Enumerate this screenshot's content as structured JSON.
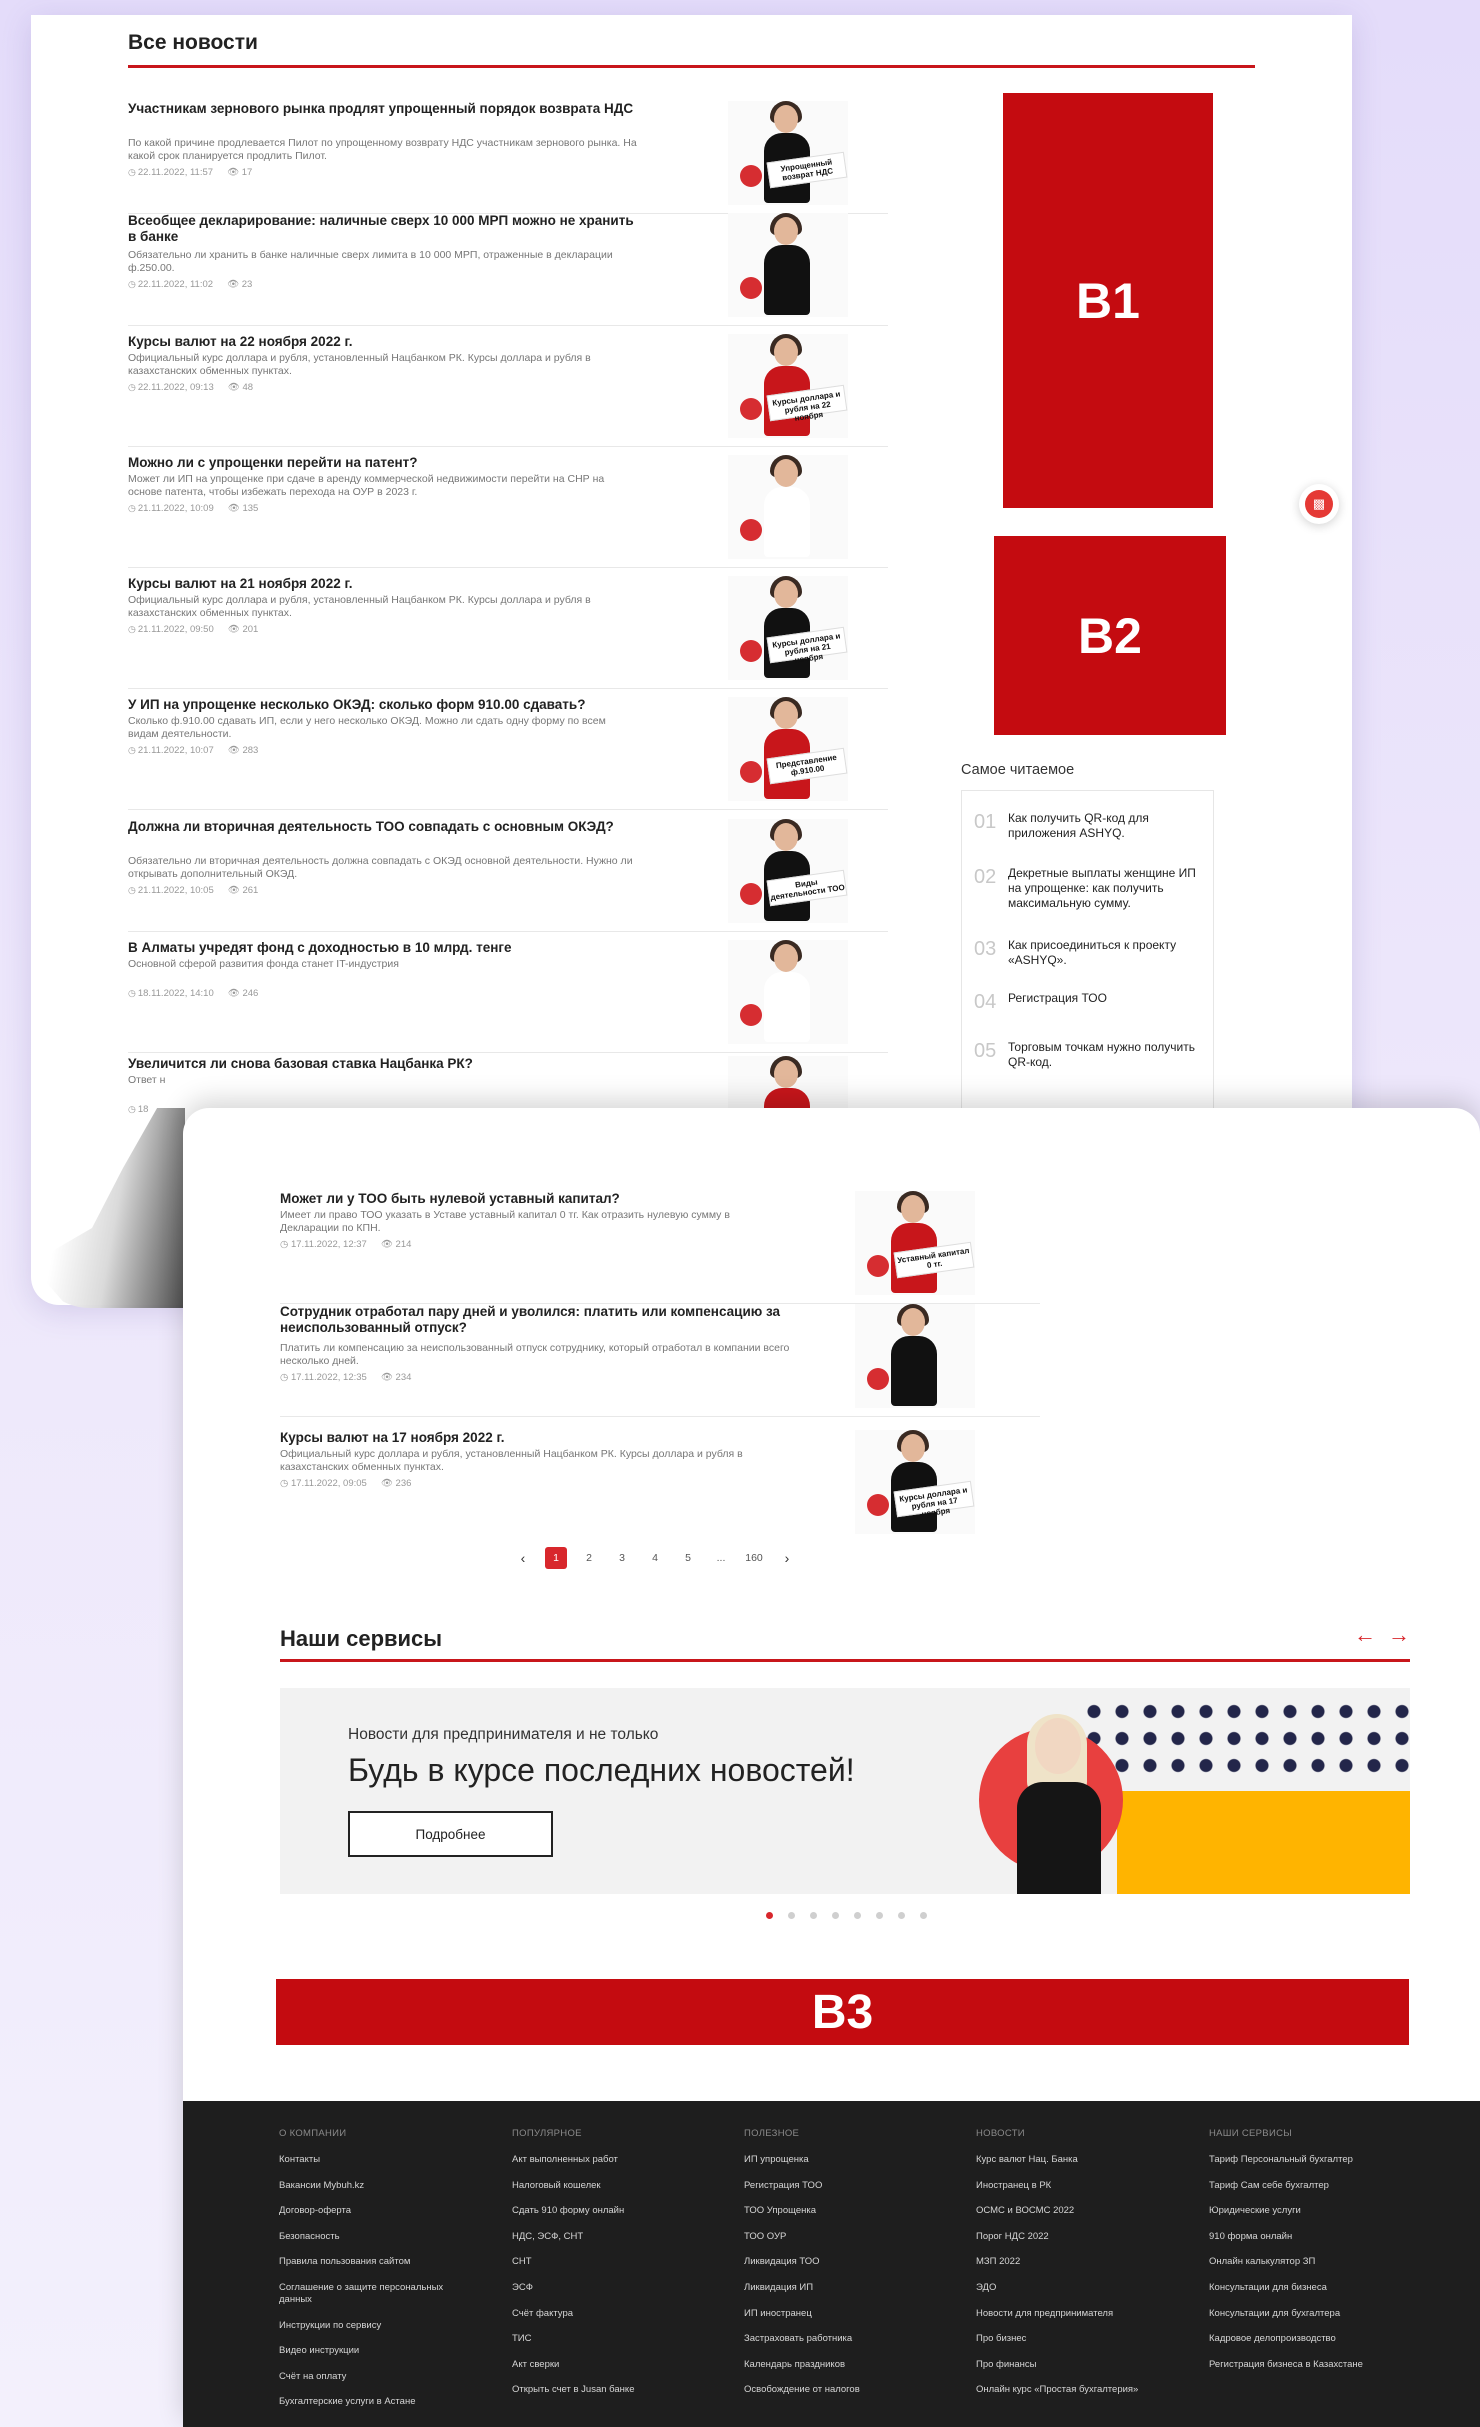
{
  "all_news": {
    "title": "Все новости",
    "items": [
      {
        "title": "Участникам зернового рынка продлят упрощенный порядок возврата НДС",
        "desc": "По какой причине продлевается Пилот по упрощенному возврату НДС участникам зернового рынка. На какой срок планируется продлить Пилот.",
        "date": "22.11.2022, 11:57",
        "views": "17",
        "sign": "Упрощенный возврат НДС"
      },
      {
        "title": "Всеобщее декларирование: наличные сверх 10 000 МРП можно не хранить в банке",
        "desc": "Обязательно ли хранить в банке наличные сверх лимита в 10 000 МРП, отраженные в декларации ф.250.00.",
        "date": "22.11.2022, 11:02",
        "views": "23",
        "sign": ""
      },
      {
        "title": "Курсы валют на 22 ноября 2022 г.",
        "desc": "Официальный курс доллара и рубля, установленный Нацбанком РК. Курсы доллара и рубля в казахстанских обменных пунктах.",
        "date": "22.11.2022, 09:13",
        "views": "48",
        "sign": "Курсы доллара и рубля на 22 ноября"
      },
      {
        "title": "Можно ли с упрощенки перейти на патент?",
        "desc": "Может ли ИП на упрощенке при сдаче в аренду коммерческой недвижимости перейти на СНР на основе патента, чтобы избежать перехода на ОУР в 2023 г.",
        "date": "21.11.2022, 10:09",
        "views": "135",
        "sign": ""
      },
      {
        "title": "Курсы валют на 21 ноября 2022 г.",
        "desc": "Официальный курс доллара и рубля, установленный Нацбанком РК. Курсы доллара и рубля в казахстанских обменных пунктах.",
        "date": "21.11.2022, 09:50",
        "views": "201",
        "sign": "Курсы доллара и рубля на 21 ноября"
      },
      {
        "title": "У ИП на упрощенке несколько ОКЭД: сколько форм 910.00 сдавать?",
        "desc": "Сколько ф.910.00 сдавать ИП, если у него несколько ОКЭД. Можно ли сдать одну форму по всем видам деятельности.",
        "date": "21.11.2022, 10:07",
        "views": "283",
        "sign": "Представление ф.910.00"
      },
      {
        "title": "Должна ли вторичная деятельность ТОО совпадать с основным ОКЭД?",
        "desc": "Обязательно ли вторичная деятельность должна совпадать с ОКЭД основной деятельности. Нужно ли открывать дополнительный ОКЭД.",
        "date": "21.11.2022, 10:05",
        "views": "261",
        "sign": "Виды деятельности ТОО"
      },
      {
        "title": "В Алматы учредят фонд с доходностью в 10 млрд. тенге",
        "desc": "Основной сферой развития фонда станет IT-индустрия",
        "date": "18.11.2022, 14:10",
        "views": "246",
        "sign": ""
      },
      {
        "title": "Увеличится ли снова базовая ставка Нацбанка РК?",
        "desc": "Ответ н",
        "date": "18",
        "views": "",
        "sign": ""
      }
    ]
  },
  "banners": {
    "b1": "B1",
    "b2": "B2",
    "b3": "B3"
  },
  "popular": {
    "title": "Самое читаемое",
    "items": [
      {
        "num": "01",
        "label": "Как получить QR-код для приложения ASHYQ."
      },
      {
        "num": "02",
        "label": "Декретные выплаты женщине ИП на упрощенке: как получить максимальную сумму."
      },
      {
        "num": "03",
        "label": "Как присоединиться к проекту «ASHYQ»."
      },
      {
        "num": "04",
        "label": "Регистрация ТОО"
      },
      {
        "num": "05",
        "label": "Торговым точкам нужно получить QR-код."
      }
    ]
  },
  "more_news": [
    {
      "title": "Может ли у ТОО быть нулевой уставный капитал?",
      "desc": "Имеет ли право ТОО указать в Уставе уставный капитал 0 тг. Как отразить нулевую сумму в Декларации по КПН.",
      "date": "17.11.2022, 12:37",
      "views": "214",
      "sign": "Уставный капитал 0 тг."
    },
    {
      "title": "Сотрудник отработал пару дней и уволился: платить или компенсацию за неиспользованный отпуск?",
      "desc": "Платить ли компенсацию за неиспользованный отпуск сотруднику, который отработал в компании всего несколько дней.",
      "date": "17.11.2022, 12:35",
      "views": "234",
      "sign": ""
    },
    {
      "title": "Курсы валют на 17 ноября 2022 г.",
      "desc": "Официальный курс доллара и рубля, установленный Нацбанком РК. Курсы доллара и рубля в казахстанских обменных пунктах.",
      "date": "17.11.2022, 09:05",
      "views": "236",
      "sign": "Курсы доллара и рубля на 17 ноября"
    }
  ],
  "pagination": {
    "prev": "‹",
    "pages": [
      "1",
      "2",
      "3",
      "4",
      "5",
      "...",
      "160"
    ],
    "next": "›",
    "active": "1"
  },
  "services": {
    "title": "Наши сервисы",
    "arrow_left": "←",
    "arrow_right": "→",
    "slide": {
      "subtitle": "Новости для предпринимателя и не только",
      "title": "Будь в курсе последних новостей!",
      "button": "Подробнее"
    },
    "dots_count": 8,
    "active_dot": 0
  },
  "footer": {
    "columns": [
      {
        "heading": "О компании",
        "items": [
          "Контакты",
          "Вакансии Mybuh.kz",
          "Договор-оферта",
          "Безопасность",
          "Правила пользования сайтом",
          "Соглашение о защите персональных данных",
          "Инструкции по сервису",
          "Видео инструкции",
          "Счёт на оплату",
          "Бухгалтерские услуги в Астане"
        ]
      },
      {
        "heading": "Популярное",
        "items": [
          "Акт выполненных работ",
          "Налоговый кошелек",
          "Сдать 910 форму онлайн",
          "НДС, ЭСФ, СНТ",
          "СНТ",
          "ЭСФ",
          "Счёт фактура",
          "ТИС",
          "Акт сверки",
          "Открыть счет в Jusan банке"
        ]
      },
      {
        "heading": "Полезное",
        "items": [
          "ИП упрощенка",
          "Регистрация ТОО",
          "ТОО Упрощенка",
          "ТОО ОУР",
          "Ликвидация ТОО",
          "Ликвидация ИП",
          "ИП иностранец",
          "Застраховать работника",
          "Календарь праздников",
          "Освобождение от налогов"
        ]
      },
      {
        "heading": "Новости",
        "items": [
          "Курс валют Нац. Банка",
          "Иностранец в РК",
          "ОСМС и ВОСМС 2022",
          "Порог НДС 2022",
          "МЗП 2022",
          "ЭДО",
          "Новости для предпринимателя",
          "Про бизнес",
          "Про финансы",
          "Онлайн курс «Простая бухгалтерия»"
        ]
      },
      {
        "heading": "Наши сервисы",
        "items": [
          "Тариф Персональный бухгалтер",
          "Тариф Сам себе бухгалтер",
          "Юридические услуги",
          "910 форма онлайн",
          "Онлайн калькулятор ЗП",
          "Консультации для бизнеса",
          "Консультации для бухгалтера",
          "Кадровое делопроизводство",
          "Регистрация бизнеса в Казахстане"
        ]
      }
    ]
  },
  "colors": {
    "accent": "#c8161b",
    "banner": "#c40b10",
    "yellow": "#ffb400",
    "footer": "#1e1e1e"
  }
}
